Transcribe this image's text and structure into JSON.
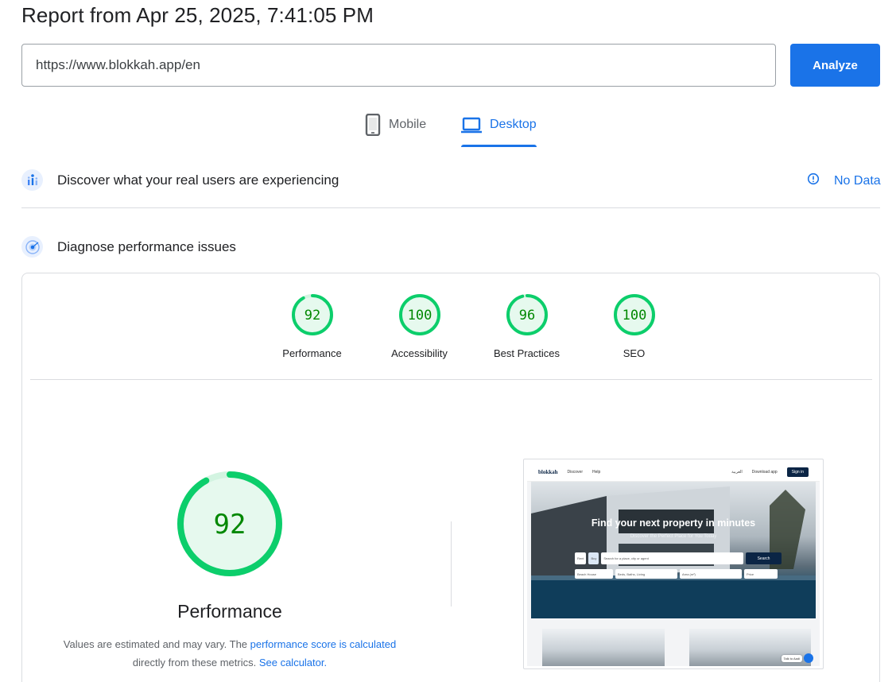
{
  "header": {
    "title": "Report from Apr 25, 2025, 7:41:05 PM"
  },
  "url_bar": {
    "value": "https://www.blokkah.app/en",
    "button_label": "Analyze"
  },
  "device_tabs": {
    "mobile_label": "Mobile",
    "desktop_label": "Desktop",
    "selected": "Desktop"
  },
  "field_data": {
    "title": "Discover what your real users are experiencing",
    "status": "No Data"
  },
  "lab_data": {
    "title": "Diagnose performance issues",
    "scores": [
      {
        "label": "Performance",
        "score": "92"
      },
      {
        "label": "Accessibility",
        "score": "100"
      },
      {
        "label": "Best Practices",
        "score": "96"
      },
      {
        "label": "SEO",
        "score": "100"
      }
    ],
    "performance": {
      "score": "92",
      "label": "Performance",
      "note_prefix": "Values are estimated and may vary. The",
      "note_link1": "performance score is calculated",
      "note_middle": "directly from these metrics.",
      "note_link2": "See calculator."
    }
  },
  "screenshot": {
    "nav_logo": "blokkah",
    "nav_discover": "Discover",
    "nav_help": "Help",
    "nav_lang": "العربية",
    "nav_download": "Download app",
    "nav_signin": "Sign in",
    "hero_title": "Find your next property in minutes",
    "hero_subtitle": "Discover the Perfect Place for You Today",
    "search_rent": "Rent",
    "search_buy": "Buy",
    "search_placeholder": "Search for a place, city or agent",
    "search_button": "Search",
    "filter_type": "Beach House",
    "filter_beds": "Beds, Baths, Living",
    "filter_area": "Area (m²)",
    "filter_price": "Price",
    "chat_label": "Talk to Aadi"
  },
  "colors": {
    "accent": "#1a73e8",
    "pass_green": "#0cce6b",
    "pass_text": "#008800",
    "pass_fill": "#e6f9ee"
  }
}
